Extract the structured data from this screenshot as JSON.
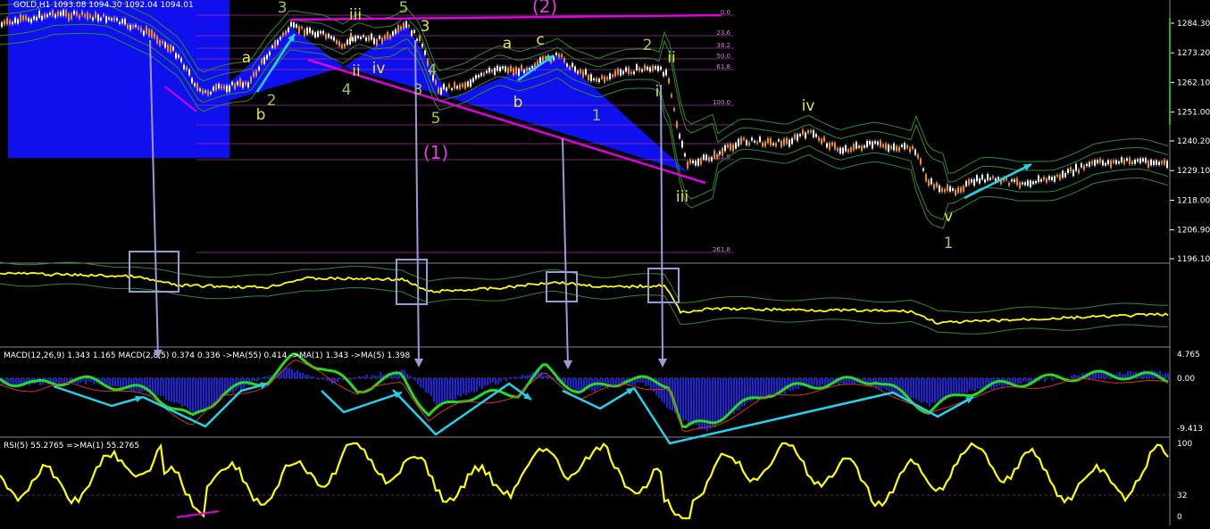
{
  "chart_data": {
    "type": "line",
    "symbol": "GOLD,H1",
    "title": "GOLD,H1  1093.08 1094.30 1092.04 1094.01",
    "ohlc": [
      "1093.08",
      "1094.30",
      "1092.04",
      "1094.01"
    ],
    "price_axis": [
      "1284.30",
      "1273.20",
      "1262.10",
      "1251.00",
      "1240.20",
      "1229.10",
      "1218.00",
      "1206.90",
      "1196.10"
    ],
    "price_ylim": [
      1196.1,
      1284.3
    ],
    "fib_levels": [
      "0.0",
      "23.6",
      "38.2",
      "50.0",
      "61.8",
      "100.0",
      "161.8",
      "261.8"
    ],
    "wave_labels": [
      "3",
      "5",
      "a",
      "c",
      "2",
      "(2)",
      "iii",
      "i",
      "ii",
      "iv",
      "iv",
      "4",
      "3",
      "5",
      "1",
      "ii",
      "b",
      "2",
      "b",
      "a",
      "1",
      "i",
      "(1)",
      "4",
      "iii",
      "v",
      "3"
    ],
    "macd_header": "MACD(12,26,9) 1.343 1.165  MACD(2,8,5) 0.374 0.336  ->MA(55) 0.414  ->MA(1) 1.343  ->MA(5) 1.398",
    "macd_axis": [
      "4.765",
      "0.00",
      "-9.413"
    ],
    "rsi_header": "RSI(5) 55.2765  =>MA(1) 55.2765",
    "rsi_axis": [
      "100",
      "32",
      "0"
    ],
    "colors": {
      "background": "#000000",
      "blue_pattern": "#1010ee",
      "candles": "#ff8c00",
      "bands": "#2e8b2e",
      "magenta": "#e000e0",
      "cyan_arrows": "#22d3ee",
      "lilac": "#9a9ad6",
      "yellow_line": "#ffff00",
      "macd_green": "#22dd22",
      "grid": "#808080"
    }
  }
}
